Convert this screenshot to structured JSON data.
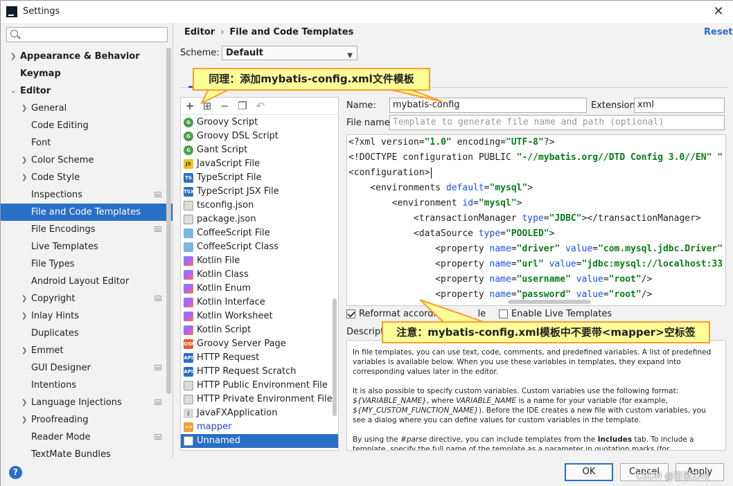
{
  "window": {
    "title": "Settings"
  },
  "search": {
    "placeholder": ""
  },
  "sidebar": {
    "items": [
      {
        "label": "Appearance & Behavior"
      },
      {
        "label": "Keymap"
      },
      {
        "label": "Editor"
      },
      {
        "label": "General"
      },
      {
        "label": "Code Editing"
      },
      {
        "label": "Font"
      },
      {
        "label": "Color Scheme"
      },
      {
        "label": "Code Style"
      },
      {
        "label": "Inspections"
      },
      {
        "label": "File and Code Templates"
      },
      {
        "label": "File Encodings"
      },
      {
        "label": "Live Templates"
      },
      {
        "label": "File Types"
      },
      {
        "label": "Android Layout Editor"
      },
      {
        "label": "Copyright"
      },
      {
        "label": "Inlay Hints"
      },
      {
        "label": "Duplicates"
      },
      {
        "label": "Emmet"
      },
      {
        "label": "GUI Designer"
      },
      {
        "label": "Intentions"
      },
      {
        "label": "Language Injections"
      },
      {
        "label": "Proofreading"
      },
      {
        "label": "Reader Mode"
      },
      {
        "label": "TextMate Bundles"
      }
    ]
  },
  "header": {
    "crumb_parent": "Editor",
    "crumb_sep": "›",
    "crumb_current": "File and Code Templates",
    "reset": "Reset"
  },
  "scheme": {
    "label": "Scheme:",
    "value": "Default"
  },
  "tabs": {
    "first": "F"
  },
  "templates": {
    "items": [
      {
        "label": "Groovy Script",
        "icon": "groovy-icon"
      },
      {
        "label": "Groovy DSL Script",
        "icon": "groovy-icon"
      },
      {
        "label": "Gant Script",
        "icon": "groovy-icon"
      },
      {
        "label": "JavaScript File",
        "icon": "javascript-icon"
      },
      {
        "label": "TypeScript File",
        "icon": "typescript-icon"
      },
      {
        "label": "TypeScript JSX File",
        "icon": "typescript-jsx-icon"
      },
      {
        "label": "tsconfig.json",
        "icon": "json-icon"
      },
      {
        "label": "package.json",
        "icon": "json-icon"
      },
      {
        "label": "CoffeeScript File",
        "icon": "coffeescript-icon"
      },
      {
        "label": "CoffeeScript Class",
        "icon": "coffeescript-icon"
      },
      {
        "label": "Kotlin File",
        "icon": "kotlin-icon"
      },
      {
        "label": "Kotlin Class",
        "icon": "kotlin-icon"
      },
      {
        "label": "Kotlin Enum",
        "icon": "kotlin-icon"
      },
      {
        "label": "Kotlin Interface",
        "icon": "kotlin-icon"
      },
      {
        "label": "Kotlin Worksheet",
        "icon": "kotlin-icon"
      },
      {
        "label": "Kotlin Script",
        "icon": "kotlin-icon"
      },
      {
        "label": "Groovy Server Page",
        "icon": "gsp-icon"
      },
      {
        "label": "HTTP Request",
        "icon": "api-icon"
      },
      {
        "label": "HTTP Request Scratch",
        "icon": "api-icon"
      },
      {
        "label": "HTTP Public Environment File",
        "icon": "json-icon"
      },
      {
        "label": "HTTP Private Environment File",
        "icon": "json-icon"
      },
      {
        "label": "JavaFXApplication",
        "icon": "javafx-icon"
      },
      {
        "label": "mapper",
        "icon": "xml-icon"
      },
      {
        "label": "Unnamed",
        "icon": "file-icon"
      }
    ]
  },
  "icon_text": {
    "js": "JS",
    "ts": "TS",
    "tsx": "TSX",
    "csp": "GSP",
    "api": "API",
    "jfx": "J",
    "xml": "<>"
  },
  "form": {
    "name_label": "Name:",
    "name_value": "mybatis-config",
    "ext_label": "Extension:",
    "ext_value": "xml",
    "filename_label": "File name:",
    "filename_placeholder": "Template to generate file name and path (optional)"
  },
  "editor": {
    "lines": [
      "<?xml version=\"1.0\" encoding=\"UTF-8\"?>",
      "<!DOCTYPE configuration PUBLIC \"-//mybatis.org//DTD Config 3.0//EN\" \"",
      "<configuration>",
      "    <environments default=\"mysql\">",
      "        <environment id=\"mysql\">",
      "            <transactionManager type=\"JDBC\"></transactionManager>",
      "            <dataSource type=\"POOLED\">",
      "                <property name=\"driver\" value=\"com.mysql.jdbc.Driver\"",
      "                <property name=\"url\" value=\"jdbc:mysql://localhost:33",
      "                <property name=\"username\" value=\"root\"/>",
      "                <property name=\"password\" value=\"root\"/>"
    ]
  },
  "options": {
    "reformat_label": "Reformat according",
    "reformat_suffix": "le",
    "live_label": "Enable Live Templates"
  },
  "description": {
    "label": "Descripti",
    "p1": "In file templates, you can use text, code, comments, and predefined variables. A list of predefined variables is available below. When you use these variables in templates, they expand into corresponding values later in the editor.",
    "p2a": "It is also possible to specify custom variables. Custom variables use the following format: ",
    "p2b": "${VARIABLE_NAME}",
    "p2c": ", where ",
    "p2d": "VARIABLE_NAME",
    "p2e": " is a name for your variable (for example, ",
    "p2f": "${MY_CUSTOM_FUNCTION_NAME}",
    "p2g": "). Before the IDE creates a new file with custom variables, you see a dialog where you can define values for custom variables in the template.",
    "p3a": "By using the ",
    "p3b": "#parse",
    "p3c": " directive, you can include templates from the ",
    "p3d": "Includes",
    "p3e": " tab. To include a template, specify the full name of the template as a parameter in quotation marks (for"
  },
  "buttons": {
    "ok": "OK",
    "cancel": "Cancel",
    "apply": "Apply",
    "help": "?"
  },
  "callouts": {
    "top": "同理：添加mybatis-config.xml文件模板",
    "bottom": "注意：mybatis-config.xml模板中不要带<mapper>空标签"
  },
  "watermark": "CSDN @百录Zmj"
}
